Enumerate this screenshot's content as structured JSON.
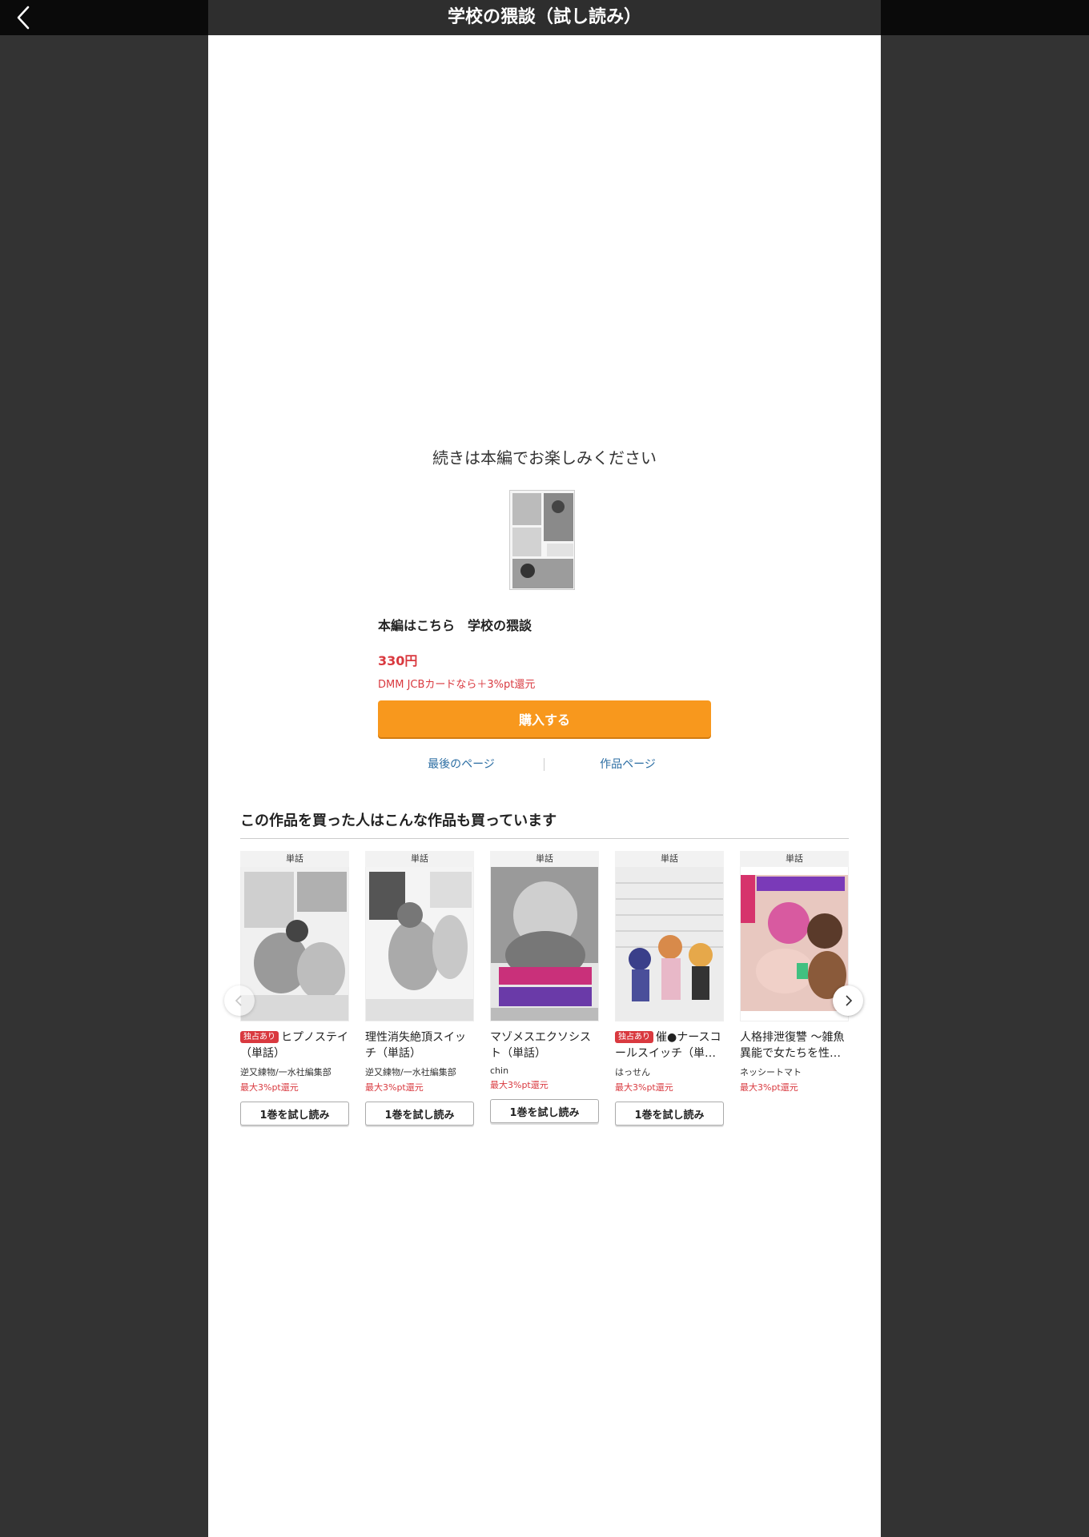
{
  "header": {
    "title": "学校の猥談（試し読み）",
    "back_icon": "chevron-left-icon"
  },
  "end": {
    "message": "続きは本編でお楽しみください",
    "main_link": "本編はこちら　学校の猥談",
    "price": "330円",
    "cashback": "DMM JCBカードなら＋3%pt還元",
    "buy_label": "購入する",
    "last_page_label": "最後のページ",
    "product_page_label": "作品ページ"
  },
  "recommend": {
    "heading": "この作品を買った人はこんな作品も買っています",
    "items": [
      {
        "type": "単話",
        "badge": "独占あり",
        "title": "ヒプノステイ（単話）",
        "author": "逆又練物/一水社編集部",
        "points": "最大3%pt還元",
        "trial": "1巻を試し読み"
      },
      {
        "type": "単話",
        "badge": "",
        "title": "理性消失絶頂スイッチ（単話）",
        "author": "逆又練物/一水社編集部",
        "points": "最大3%pt還元",
        "trial": "1巻を試し読み"
      },
      {
        "type": "単話",
        "badge": "",
        "title": "マゾメスエクソシスト（単話）",
        "author": "chin",
        "points": "最大3%pt還元",
        "trial": "1巻を試し読み"
      },
      {
        "type": "単話",
        "badge": "独占あり",
        "title": "催●ナースコールスイッチ（単…",
        "author": "はっせん",
        "points": "最大3%pt還元",
        "trial": "1巻を試し読み"
      },
      {
        "type": "単話",
        "badge": "",
        "title": "人格排泄復讐 〜雑魚異能で女たちを性…",
        "author": "ネッシートマト",
        "points": "最大3%pt還元",
        "trial": ""
      }
    ]
  },
  "colors": {
    "accent": "#f8981d",
    "price_red": "#d9393f",
    "link_blue": "#2c6ea3"
  }
}
